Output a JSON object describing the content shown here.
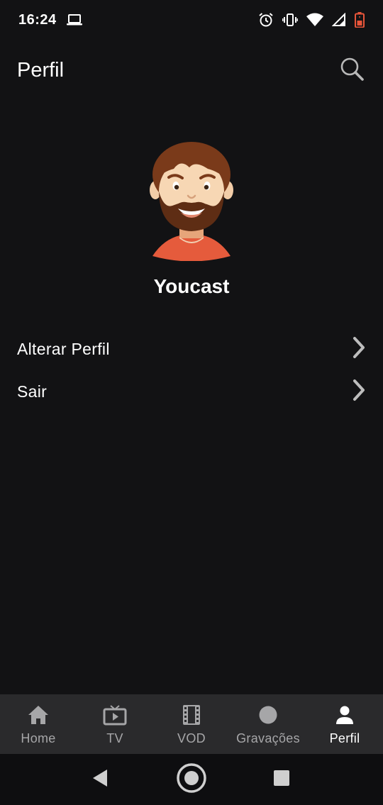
{
  "status_bar": {
    "time": "16:24",
    "icons": [
      "laptop-icon",
      "alarm-icon",
      "vibrate-icon",
      "wifi-icon",
      "signal-icon",
      "battery-low-icon"
    ]
  },
  "app_bar": {
    "title": "Perfil",
    "search_icon": "search-icon"
  },
  "profile": {
    "avatar": "avatar-bearded-man",
    "name": "Youcast"
  },
  "menu": {
    "items": [
      {
        "label": "Alterar Perfil",
        "icon": "chevron-right-icon"
      },
      {
        "label": "Sair",
        "icon": "chevron-right-icon"
      }
    ]
  },
  "bottom_nav": {
    "items": [
      {
        "label": "Home",
        "icon": "home-icon",
        "active": false
      },
      {
        "label": "TV",
        "icon": "tv-icon",
        "active": false
      },
      {
        "label": "VOD",
        "icon": "film-icon",
        "active": false
      },
      {
        "label": "Gravações",
        "icon": "record-icon",
        "active": false
      },
      {
        "label": "Perfil",
        "icon": "person-icon",
        "active": true
      }
    ]
  },
  "colors": {
    "background": "#121214",
    "nav_background": "#2a2a2c",
    "inactive": "#a6a6a8",
    "active": "#ffffff",
    "battery_warning": "#e8553a"
  }
}
